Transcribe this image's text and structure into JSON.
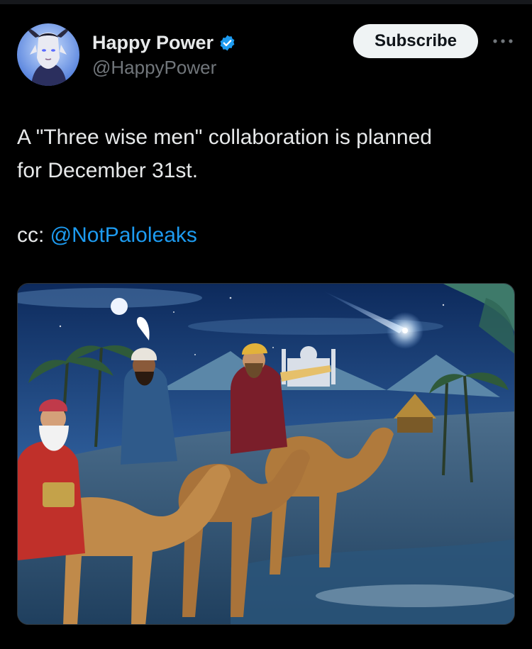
{
  "post": {
    "author": {
      "display_name": "Happy Power",
      "handle": "@HappyPower",
      "verified": true,
      "avatar": "avatar-fantasy-character"
    },
    "subscribe_label": "Subscribe",
    "more_icon": "more-horizontal-icon",
    "text_lines": [
      "A \"Three wise men\" collaboration is planned",
      "for December 31st."
    ],
    "cc_prefix": "cc: ",
    "mention": "@NotPaloleaks",
    "media": {
      "type": "image",
      "subject": "three-wise-men-on-camels-illustration"
    }
  },
  "colors": {
    "background": "#000000",
    "text": "#e7e9ea",
    "secondary_text": "#71767b",
    "link": "#1d9bf0",
    "verified_badge": "#1d9bf0",
    "button_bg": "#eff3f4"
  }
}
